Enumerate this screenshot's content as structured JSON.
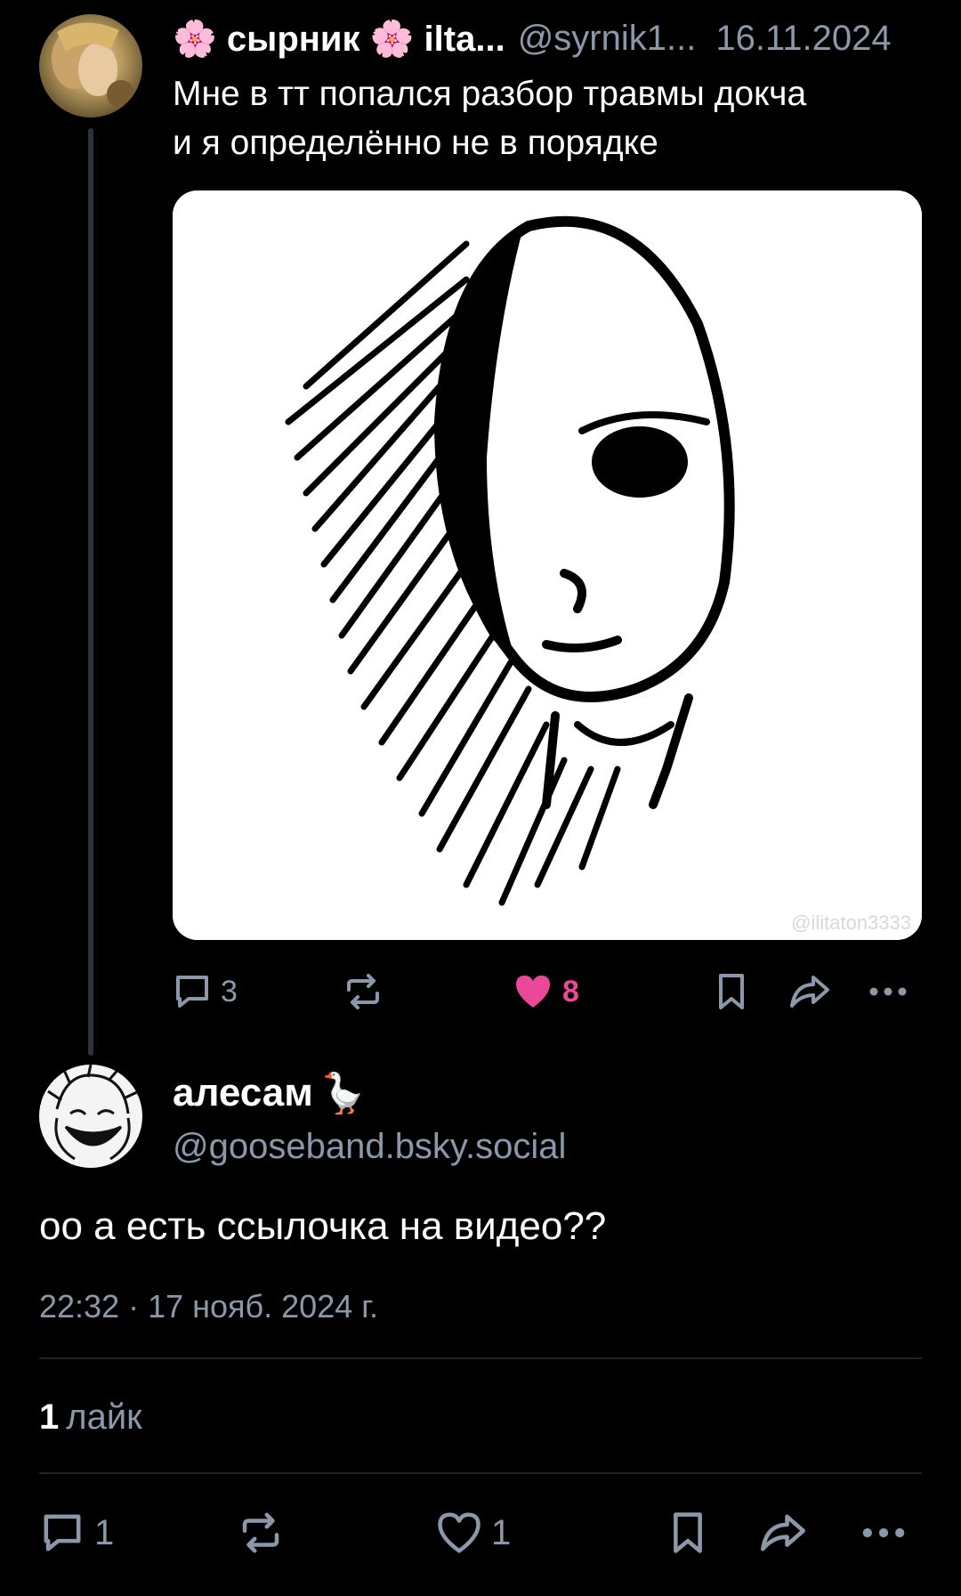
{
  "parent_post": {
    "author_name": "🌸 сырник 🌸 ilta...",
    "author_handle": "@syrnik1...",
    "date": "16.11.2024",
    "text_lines": [
      "Мне в тт попался разбор травмы докча",
      "и я определённо не в порядке"
    ],
    "image_watermark": "@ilitaton3333",
    "actions": {
      "reply_count": "3",
      "like_count": "8",
      "liked": true
    }
  },
  "reply_post": {
    "author_name": "алесам",
    "author_emoji": "🪿",
    "author_handle": "@gooseband.bsky.social",
    "text": "оо а есть ссылочка на видео??",
    "timestamp": "22:32 · 17 нояб. 2024 г.",
    "likes_count": "1",
    "likes_label": "лайк",
    "actions": {
      "reply_count": "1",
      "like_count": "1"
    }
  },
  "colors": {
    "background": "#000000",
    "text_primary": "#ffffff",
    "text_secondary": "#8b98a9",
    "like_active": "#ec4899",
    "divider": "#1e2530"
  },
  "icons": [
    "reply-icon",
    "repost-icon",
    "heart-icon",
    "bookmark-icon",
    "share-icon",
    "more-icon"
  ]
}
